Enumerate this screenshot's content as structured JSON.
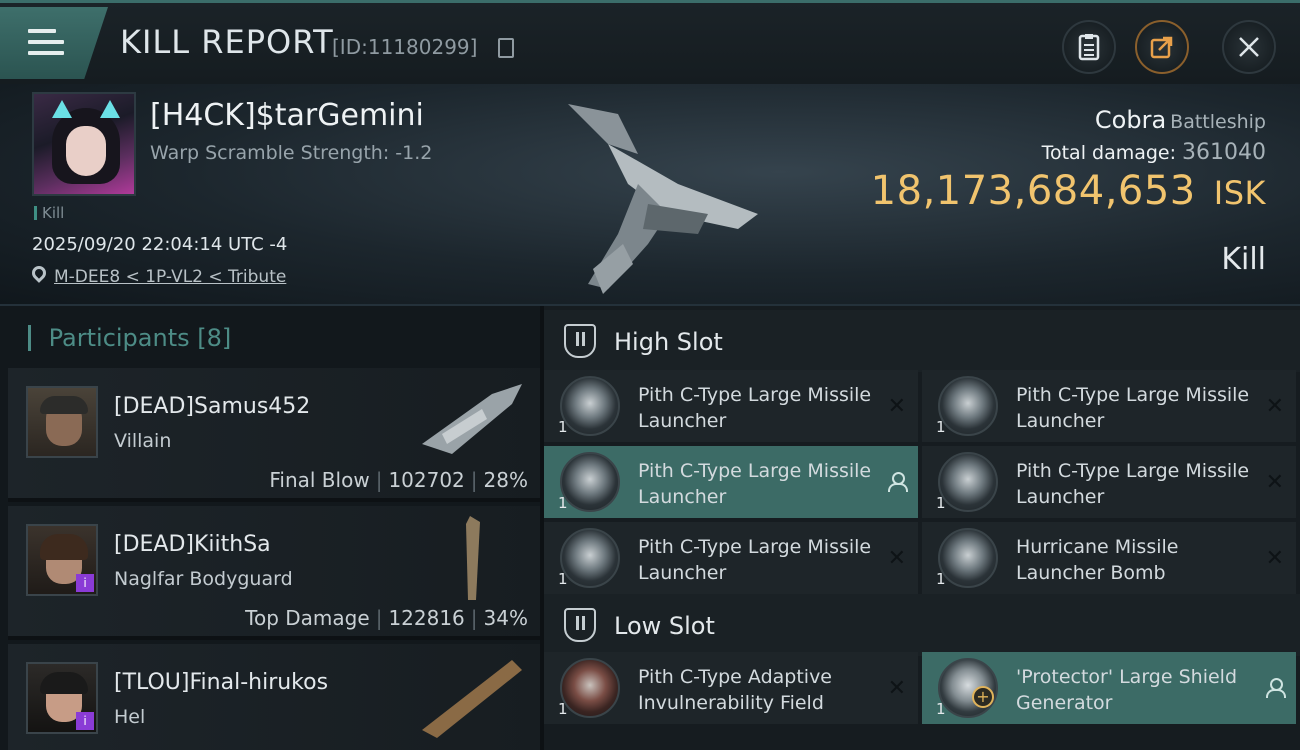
{
  "header": {
    "title": "KILL REPORT",
    "report_id": "[ID:11180299]",
    "icons": {
      "menu": "menu-icon",
      "copy": "copy-icon",
      "clipboard": "clipboard-icon",
      "share": "share-icon",
      "close": "close-icon"
    }
  },
  "victim": {
    "name": "[H4CK]$tarGemini",
    "subtitle": "Warp Scramble Strength: -1.2",
    "kill_tag": "Kill",
    "timestamp": "2025/09/20 22:04:14 UTC -4",
    "location": "M-DEE8 < 1P-VL2 < Tribute",
    "ship_name": "Cobra",
    "ship_class": "Battleship",
    "total_damage_label": "Total damage:",
    "total_damage": "361040",
    "isk_value": "18,173,684,653",
    "isk_unit": "ISK",
    "result": "Kill"
  },
  "participants": {
    "label": "Participants",
    "count": "[8]",
    "rows": [
      {
        "name": "[DEAD]Samus452",
        "role": "Villain",
        "stat_label": "Final Blow",
        "damage": "102702",
        "percent": "28%"
      },
      {
        "name": "[DEAD]KiithSa",
        "role": "Naglfar Bodyguard",
        "stat_label": "Top Damage",
        "damage": "122816",
        "percent": "34%"
      },
      {
        "name": "[TLOU]Final-hirukos",
        "role": "Hel",
        "stat_label": "",
        "damage": "",
        "percent": ""
      }
    ]
  },
  "fittings": {
    "high_slot": {
      "title": "High Slot",
      "modules": [
        {
          "name": "Pith C-Type Large Missile Launcher",
          "qty": "1",
          "marker": "x"
        },
        {
          "name": "Pith C-Type Large Missile Launcher",
          "qty": "1",
          "marker": "x"
        },
        {
          "name": "Pith C-Type Large Missile Launcher",
          "qty": "1",
          "marker": "user"
        },
        {
          "name": "Pith C-Type Large Missile Launcher",
          "qty": "1",
          "marker": "x"
        },
        {
          "name": "Pith C-Type Large Missile Launcher",
          "qty": "1",
          "marker": "x"
        },
        {
          "name": "Hurricane Missile Launcher Bomb",
          "qty": "1",
          "marker": "x"
        }
      ]
    },
    "low_slot": {
      "title": "Low Slot",
      "modules": [
        {
          "name": "Pith C-Type Adaptive Invulnerability Field",
          "qty": "1",
          "marker": "x"
        },
        {
          "name": "'Protector' Large Shield Generator",
          "qty": "1",
          "marker": "user"
        }
      ]
    }
  },
  "colors": {
    "accent": "#3c6b66",
    "isk": "#f1c46e",
    "share": "#e8a04a"
  }
}
